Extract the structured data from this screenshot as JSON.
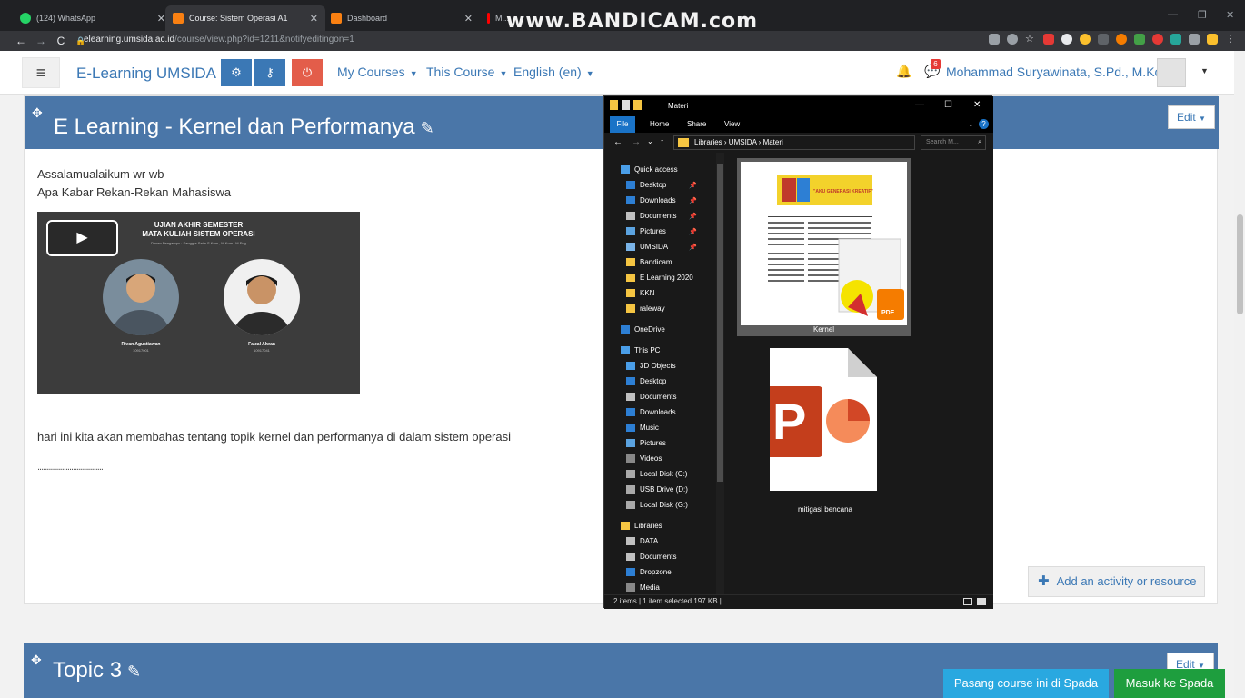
{
  "browser": {
    "tabs": [
      {
        "title": "(124) WhatsApp",
        "icon": "whatsapp-icon",
        "color": "#25d366"
      },
      {
        "title": "Course: Sistem Operasi A1",
        "icon": "moodle-icon",
        "color": "#f98012"
      },
      {
        "title": "Dashboard",
        "icon": "moodle-icon",
        "color": "#f98012"
      },
      {
        "title": "M...",
        "icon": "youtube-icon",
        "color": "#ff0000"
      }
    ],
    "watermark": "www.BANDICAM.com",
    "url_host": "elearning.umsida.ac.id",
    "url_path": "/course/view.php?id=1211&notifyeditingon=1"
  },
  "navbar": {
    "brand": "E-Learning UMSIDA",
    "menus": [
      "My Courses",
      "This Course",
      "English (en)"
    ],
    "message_count": "6",
    "user_name": "Mohammad Suryawinata, S.Pd., M.Kom"
  },
  "section": {
    "title": "E Learning - Kernel dan Performanya",
    "edit_label": "Edit",
    "greeting_line1": "Assalamualaikum wr wb",
    "greeting_line2": "Apa Kabar Rekan-Rekan Mahasiswa",
    "video": {
      "title_line1": "UJIAN AKHIR SEMESTER",
      "title_line2": "MATA KULIAH SISTEM OPERASI",
      "subtitle": "Dosen Pengampu : Sanggra Satia S.Kom., M.Kom., M.Eng",
      "person1_name": "Rivan Agustiawan",
      "person1_id": "10917001",
      "person2_name": "Faizal Alwan",
      "person2_id": "10917041"
    },
    "body_text": "hari ini kita akan membahas tentang topik kernel dan performanya di dalam sistem operasi",
    "dots": "...................................",
    "add_activity": "Add an activity or resource"
  },
  "section2": {
    "title": "Topic 3",
    "edit_label": "Edit"
  },
  "buttons": {
    "pasang": "Pasang course ini di Spada",
    "masuk": "Masuk ke Spada"
  },
  "explorer": {
    "title": "Materi",
    "ribbon": [
      "File",
      "Home",
      "Share",
      "View"
    ],
    "path": "Libraries  ›  UMSIDA  ›  Materi",
    "search_placeholder": "Search M...",
    "nav": [
      {
        "label": "Quick access",
        "indent": 0,
        "color": "#4a9ee8",
        "pin": false
      },
      {
        "label": "Desktop",
        "indent": 1,
        "color": "#2d7fd4",
        "pin": true
      },
      {
        "label": "Downloads",
        "indent": 1,
        "color": "#2d7fd4",
        "pin": true
      },
      {
        "label": "Documents",
        "indent": 1,
        "color": "#c0c0c0",
        "pin": true
      },
      {
        "label": "Pictures",
        "indent": 1,
        "color": "#5ba3e0",
        "pin": true
      },
      {
        "label": "UMSIDA",
        "indent": 1,
        "color": "#7ab4e8",
        "pin": true
      },
      {
        "label": "Bandicam",
        "indent": 1,
        "color": "#f5c542",
        "pin": false
      },
      {
        "label": "E Learning 2020",
        "indent": 1,
        "color": "#f5c542",
        "pin": false
      },
      {
        "label": "KKN",
        "indent": 1,
        "color": "#f5c542",
        "pin": false
      },
      {
        "label": "raleway",
        "indent": 1,
        "color": "#f5c542",
        "pin": false
      },
      {
        "label": "OneDrive",
        "indent": 0,
        "color": "#2d7fd4",
        "pin": false
      },
      {
        "label": "This PC",
        "indent": 0,
        "color": "#4a9ee8",
        "pin": false
      },
      {
        "label": "3D Objects",
        "indent": 1,
        "color": "#4a9ee8",
        "pin": false
      },
      {
        "label": "Desktop",
        "indent": 1,
        "color": "#2d7fd4",
        "pin": false
      },
      {
        "label": "Documents",
        "indent": 1,
        "color": "#c0c0c0",
        "pin": false
      },
      {
        "label": "Downloads",
        "indent": 1,
        "color": "#2d7fd4",
        "pin": false
      },
      {
        "label": "Music",
        "indent": 1,
        "color": "#2d7fd4",
        "pin": false
      },
      {
        "label": "Pictures",
        "indent": 1,
        "color": "#5ba3e0",
        "pin": false
      },
      {
        "label": "Videos",
        "indent": 1,
        "color": "#888888",
        "pin": false
      },
      {
        "label": "Local Disk (C:)",
        "indent": 1,
        "color": "#aaaaaa",
        "pin": false
      },
      {
        "label": "USB Drive (D:)",
        "indent": 1,
        "color": "#aaaaaa",
        "pin": false
      },
      {
        "label": "Local Disk (G:)",
        "indent": 1,
        "color": "#aaaaaa",
        "pin": false
      },
      {
        "label": "Libraries",
        "indent": 0,
        "color": "#f5c542",
        "pin": false
      },
      {
        "label": "DATA",
        "indent": 1,
        "color": "#c0c0c0",
        "pin": false
      },
      {
        "label": "Documents",
        "indent": 1,
        "color": "#c0c0c0",
        "pin": false
      },
      {
        "label": "Dropzone",
        "indent": 1,
        "color": "#2d7fd4",
        "pin": false
      },
      {
        "label": "Media",
        "indent": 1,
        "color": "#888888",
        "pin": false
      }
    ],
    "files": [
      {
        "name": "Kernel",
        "type": "pdf"
      },
      {
        "name": "mitigasi bencana",
        "type": "pptx"
      }
    ],
    "pdf_banner": "\"AKU GENERASI KREATIF\"",
    "pdf_badge": "PDF",
    "ppt_letter": "P",
    "status": "2 items  |  1 item selected  197 KB  |"
  }
}
